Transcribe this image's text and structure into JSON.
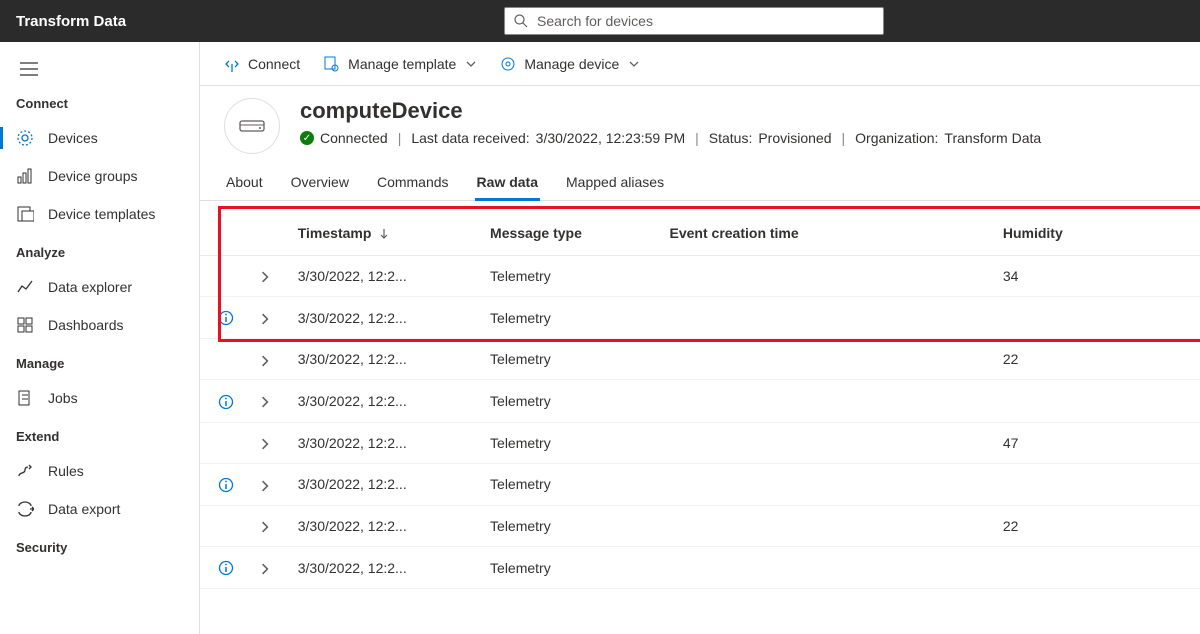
{
  "app": {
    "title": "Transform Data"
  },
  "search": {
    "placeholder": "Search for devices"
  },
  "sidebar": {
    "sections": [
      {
        "header": "Connect",
        "items": [
          {
            "id": "devices",
            "label": "Devices",
            "active": true
          },
          {
            "id": "device-groups",
            "label": "Device groups"
          },
          {
            "id": "device-templates",
            "label": "Device templates"
          }
        ]
      },
      {
        "header": "Analyze",
        "items": [
          {
            "id": "data-explorer",
            "label": "Data explorer"
          },
          {
            "id": "dashboards",
            "label": "Dashboards"
          }
        ]
      },
      {
        "header": "Manage",
        "items": [
          {
            "id": "jobs",
            "label": "Jobs"
          }
        ]
      },
      {
        "header": "Extend",
        "items": [
          {
            "id": "rules",
            "label": "Rules"
          },
          {
            "id": "data-export",
            "label": "Data export"
          }
        ]
      },
      {
        "header": "Security",
        "items": []
      }
    ]
  },
  "actions": {
    "connect": "Connect",
    "manage_template": "Manage template",
    "manage_device": "Manage device"
  },
  "device": {
    "name": "computeDevice",
    "status_text": "Connected",
    "last_data_label": "Last data received:",
    "last_data_value": "3/30/2022, 12:23:59 PM",
    "status_label": "Status:",
    "status_value": "Provisioned",
    "org_label": "Organization:",
    "org_value": "Transform Data"
  },
  "tabs": [
    {
      "id": "about",
      "label": "About"
    },
    {
      "id": "overview",
      "label": "Overview"
    },
    {
      "id": "commands",
      "label": "Commands"
    },
    {
      "id": "raw",
      "label": "Raw data",
      "active": true
    },
    {
      "id": "mapped",
      "label": "Mapped aliases"
    }
  ],
  "table": {
    "headers": {
      "timestamp": "Timestamp",
      "message_type": "Message type",
      "event_creation_time": "Event creation time",
      "humidity": "Humidity"
    },
    "rows": [
      {
        "info": false,
        "ts": "3/30/2022, 12:2...",
        "mt": "Telemetry",
        "ect": "",
        "h": "34"
      },
      {
        "info": true,
        "ts": "3/30/2022, 12:2...",
        "mt": "Telemetry",
        "ect": "",
        "h": ""
      },
      {
        "info": false,
        "ts": "3/30/2022, 12:2...",
        "mt": "Telemetry",
        "ect": "",
        "h": "22"
      },
      {
        "info": true,
        "ts": "3/30/2022, 12:2...",
        "mt": "Telemetry",
        "ect": "",
        "h": ""
      },
      {
        "info": false,
        "ts": "3/30/2022, 12:2...",
        "mt": "Telemetry",
        "ect": "",
        "h": "47"
      },
      {
        "info": true,
        "ts": "3/30/2022, 12:2...",
        "mt": "Telemetry",
        "ect": "",
        "h": ""
      },
      {
        "info": false,
        "ts": "3/30/2022, 12:2...",
        "mt": "Telemetry",
        "ect": "",
        "h": "22"
      },
      {
        "info": true,
        "ts": "3/30/2022, 12:2...",
        "mt": "Telemetry",
        "ect": "",
        "h": ""
      }
    ]
  }
}
